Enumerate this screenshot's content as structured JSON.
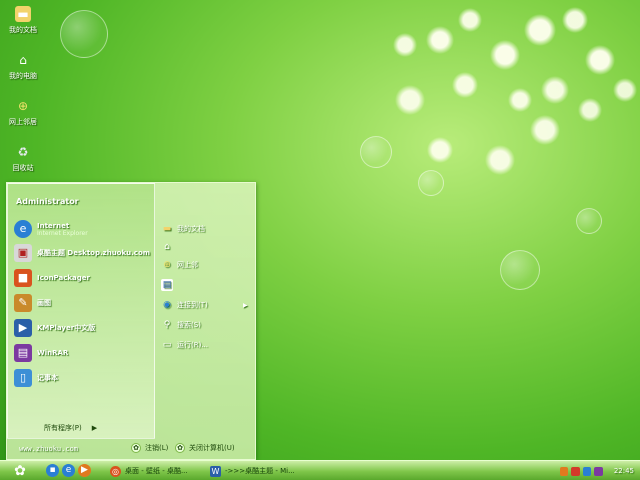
{
  "desktop": {
    "icons": [
      {
        "label": "我的文档",
        "icon": "folder-icon"
      },
      {
        "label": "我的电脑",
        "icon": "computer-icon"
      },
      {
        "label": "网上邻居",
        "icon": "network-icon"
      },
      {
        "label": "回收站",
        "icon": "recycle-bin-icon"
      }
    ]
  },
  "start_menu": {
    "user_name": "Administrator",
    "pinned": [
      {
        "name": "Internet",
        "subtitle": "Internet Explorer",
        "icon": "internet-explorer-icon",
        "color": "#2a7fd4"
      },
      {
        "name": "桌酷主题 Desktop.zhuoku.com",
        "icon": "zhuoku-theme-icon",
        "color": "#d8d8d8"
      }
    ],
    "programs": [
      {
        "name": "IconPackager",
        "icon": "iconpackager-icon",
        "color": "#d9531e"
      },
      {
        "name": "画图",
        "icon": "paint-icon",
        "color": "#c98a2b"
      },
      {
        "name": "KMPlayer中文版",
        "icon": "kmplayer-icon",
        "color": "#2a5fa8"
      },
      {
        "name": "WinRAR",
        "icon": "winrar-icon",
        "color": "#7b3aa0"
      },
      {
        "name": "记事本",
        "icon": "notepad-icon",
        "color": "#3d8fd6"
      }
    ],
    "all_programs": "所有程序(P)",
    "url": "www.zhuoku.com",
    "right_items": [
      {
        "label": "我的文档",
        "icon": "documents-icon"
      },
      {
        "label": "",
        "icon": "computer-icon"
      },
      {
        "label": "网上邻",
        "icon": "network-icon"
      },
      {
        "label": "",
        "icon": "control-panel-icon"
      },
      {
        "label": "连接到(T)",
        "icon": "connect-icon",
        "submenu": true
      },
      {
        "label": "搜索(S)",
        "icon": "search-icon"
      },
      {
        "label": "运行(R)...",
        "icon": "run-icon"
      }
    ],
    "logoff": "注销(L)",
    "shutdown": "关闭计算机(U)"
  },
  "taskbar": {
    "quick_launch": [
      {
        "icon": "show-desktop-icon",
        "color": "#2a7fd4"
      },
      {
        "icon": "internet-explorer-icon",
        "color": "#2a7fd4"
      },
      {
        "icon": "media-player-icon",
        "color": "#e07a1f"
      }
    ],
    "tasks": [
      {
        "label": "桌面 - 壁纸 - 桌酷...",
        "icon": "browser-icon",
        "color": "#d9531e"
      },
      {
        "label": "->>>桌酷主题 - Mi...",
        "icon": "word-icon",
        "color": "#2a5fa8"
      }
    ],
    "tray_colors": [
      "#e07a1f",
      "#d33a2a",
      "#2a7fd4",
      "#7b3aa0"
    ],
    "clock": "22:45"
  }
}
